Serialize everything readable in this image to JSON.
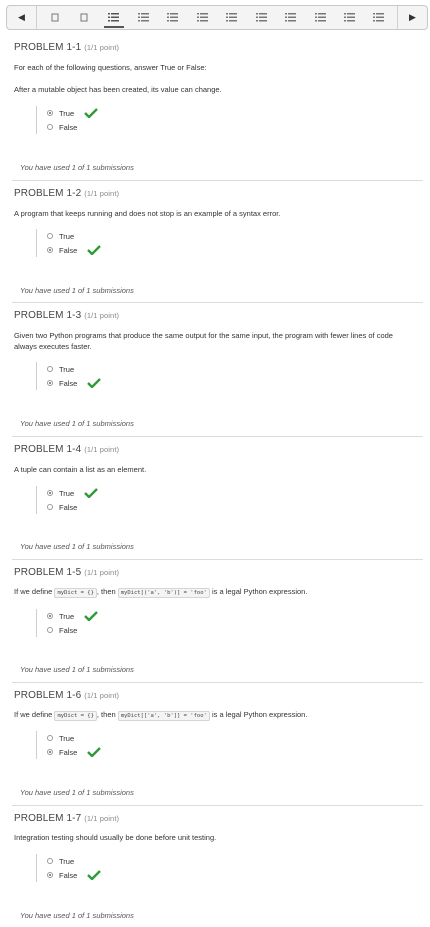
{
  "nav": {
    "prev_icon": "triangle-left",
    "next_icon": "triangle-right",
    "active_tab": 2
  },
  "intro": "For each of the following questions, answer True or False:",
  "used_text": "You have used 1 of 1 submissions",
  "problems": [
    {
      "title": "PROBLEM 1-1",
      "points": "(1/1 point)",
      "question": "After a mutable object has been created, its value can change.",
      "choices": [
        "True",
        "False"
      ],
      "selected": 0
    },
    {
      "title": "PROBLEM 1-2",
      "points": "(1/1 point)",
      "question": "A program that keeps running and does not stop is an example of a syntax error.",
      "choices": [
        "True",
        "False"
      ],
      "selected": 1
    },
    {
      "title": "PROBLEM 1-3",
      "points": "(1/1 point)",
      "question": "Given two Python programs that produce the same output for the same input, the program with fewer lines of code always executes faster.",
      "choices": [
        "True",
        "False"
      ],
      "selected": 1
    },
    {
      "title": "PROBLEM 1-4",
      "points": "(1/1 point)",
      "question": "A tuple can contain a list as an element.",
      "choices": [
        "True",
        "False"
      ],
      "selected": 0
    },
    {
      "title": "PROBLEM 1-5",
      "points": "(1/1 point)",
      "q_pre": "If we define",
      "code1": "myDict = {}",
      "q_mid": ", then",
      "code2": "myDict[('a', 'b')] = 'foo'",
      "q_post": "is a legal Python expression.",
      "choices": [
        "True",
        "False"
      ],
      "selected": 0
    },
    {
      "title": "PROBLEM 1-6",
      "points": "(1/1 point)",
      "q_pre": "If we define",
      "code1": "myDict = {}",
      "q_mid": ", then",
      "code2": "myDict[['a', 'b']] = 'foo'",
      "q_post": "is a legal Python expression.",
      "choices": [
        "True",
        "False"
      ],
      "selected": 1
    },
    {
      "title": "PROBLEM 1-7",
      "points": "(1/1 point)",
      "question": "Integration testing should usually be done before unit testing.",
      "choices": [
        "True",
        "False"
      ],
      "selected": 1
    }
  ],
  "colors": {
    "check": "#2e9b36",
    "text": "#3c3c3c"
  }
}
